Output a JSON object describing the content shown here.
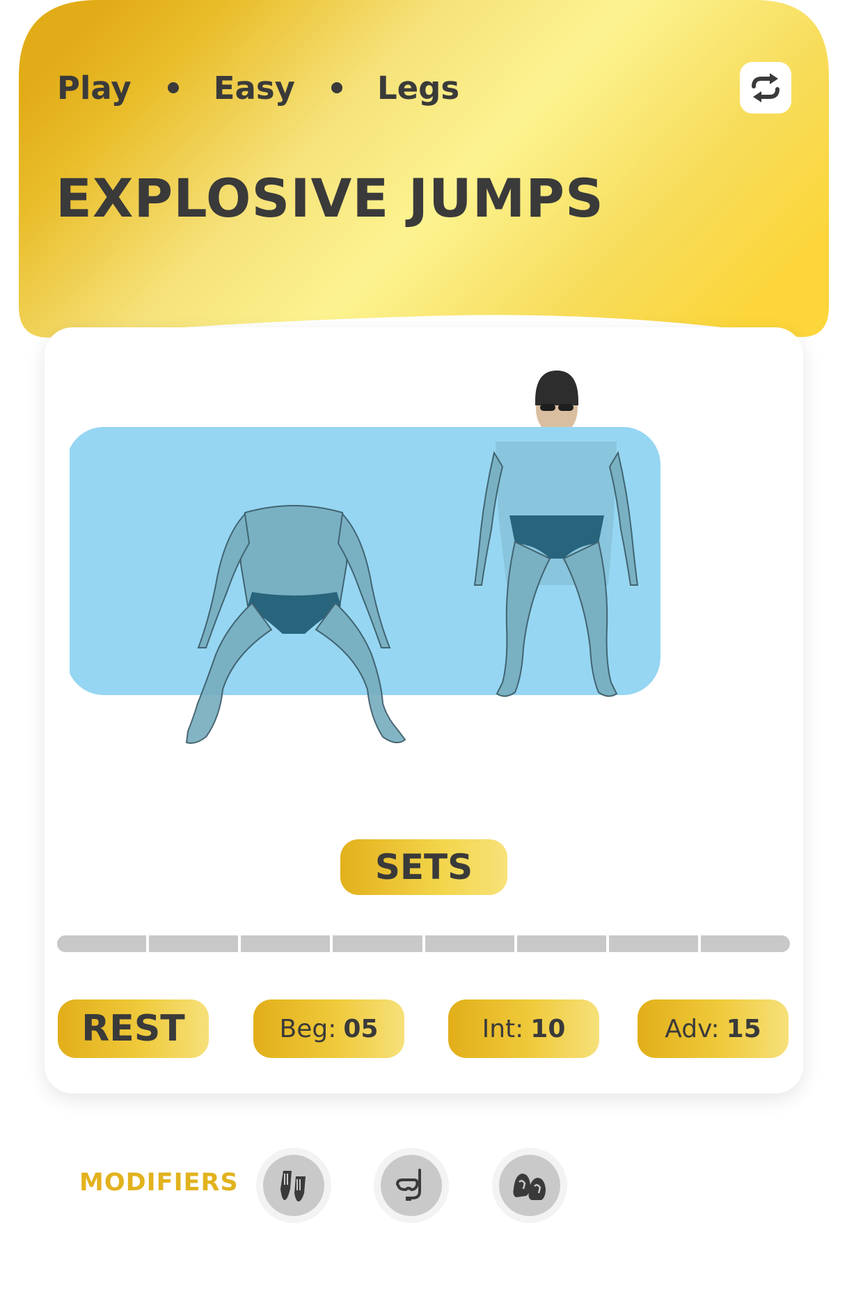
{
  "header": {
    "tags": [
      "Play",
      "Easy",
      "Legs"
    ],
    "title": "EXPLOSIVE JUMPS",
    "refresh_icon": "refresh-icon",
    "gradient_colors": [
      "#e3ae1c",
      "#fbf38c",
      "#fbd73e"
    ]
  },
  "illustration": {
    "pool_color": "#96d6f2",
    "figures": [
      "squatting-swimmer",
      "standing-swimmer"
    ]
  },
  "sets": {
    "label": "SETS",
    "segments_total": 8,
    "segments_completed": 0
  },
  "buttons": {
    "rest": "REST",
    "beginner": {
      "label": "Beg:",
      "value": "05"
    },
    "intermediate": {
      "label": "Int:",
      "value": "10"
    },
    "advanced": {
      "label": "Adv:",
      "value": "15"
    }
  },
  "modifiers": {
    "label": "MODIFIERS",
    "separator": ":",
    "items": [
      {
        "icon": "fins-icon"
      },
      {
        "icon": "snorkel-mask-icon"
      },
      {
        "icon": "paddles-icon"
      }
    ]
  }
}
